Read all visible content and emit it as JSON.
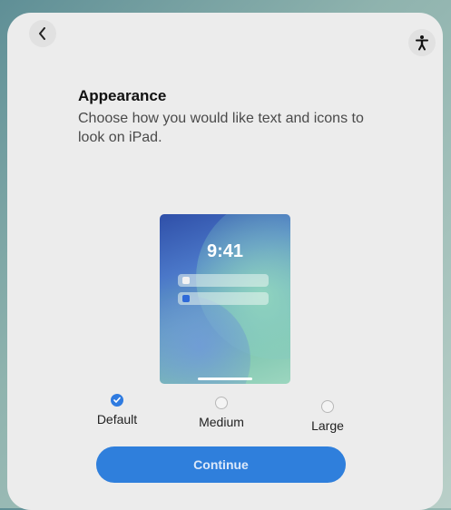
{
  "nav": {
    "back_icon": "chevron-left-icon",
    "accessibility_icon": "accessibility-person-icon"
  },
  "header": {
    "title": "Appearance",
    "subtitle": "Choose how you would like text and icons to look on iPad."
  },
  "preview": {
    "time": "9:41"
  },
  "options": [
    {
      "label": "Default",
      "selected": true
    },
    {
      "label": "Medium",
      "selected": false
    },
    {
      "label": "Large",
      "selected": false
    }
  ],
  "continue_label": "Continue",
  "colors": {
    "accent": "#2f7fdc",
    "sheet": "#ececec"
  }
}
